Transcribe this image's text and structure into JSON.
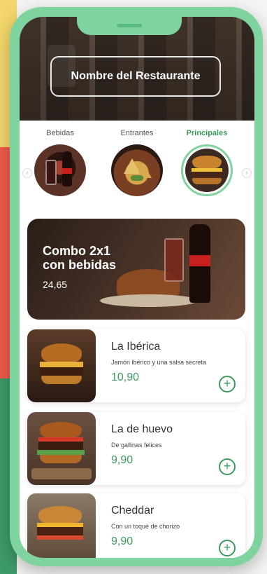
{
  "header": {
    "restaurant_name": "Nombre del Restaurante"
  },
  "categories": [
    {
      "label": "Bebidas",
      "icon": "soda-glass-icon",
      "active": false
    },
    {
      "label": "Entrantes",
      "icon": "nachos-icon",
      "active": false
    },
    {
      "label": "Principales",
      "icon": "burger-icon",
      "active": true
    }
  ],
  "promo": {
    "title": "Combo 2x1 con bebidas",
    "price": "24,65"
  },
  "items": [
    {
      "name": "La Ibérica",
      "desc": "Jamón ibérico y una salsa secreta",
      "price": "10,90"
    },
    {
      "name": "La de huevo",
      "desc": "De gallinas felices",
      "price": "9,90"
    },
    {
      "name": "Cheddar",
      "desc": "Con un toque de chorizo",
      "price": "9,90"
    }
  ],
  "colors": {
    "accent": "#3c9a5f",
    "frame": "#7ed39e"
  },
  "add_label": "+",
  "nav": {
    "prev": "‹",
    "next": "›"
  }
}
